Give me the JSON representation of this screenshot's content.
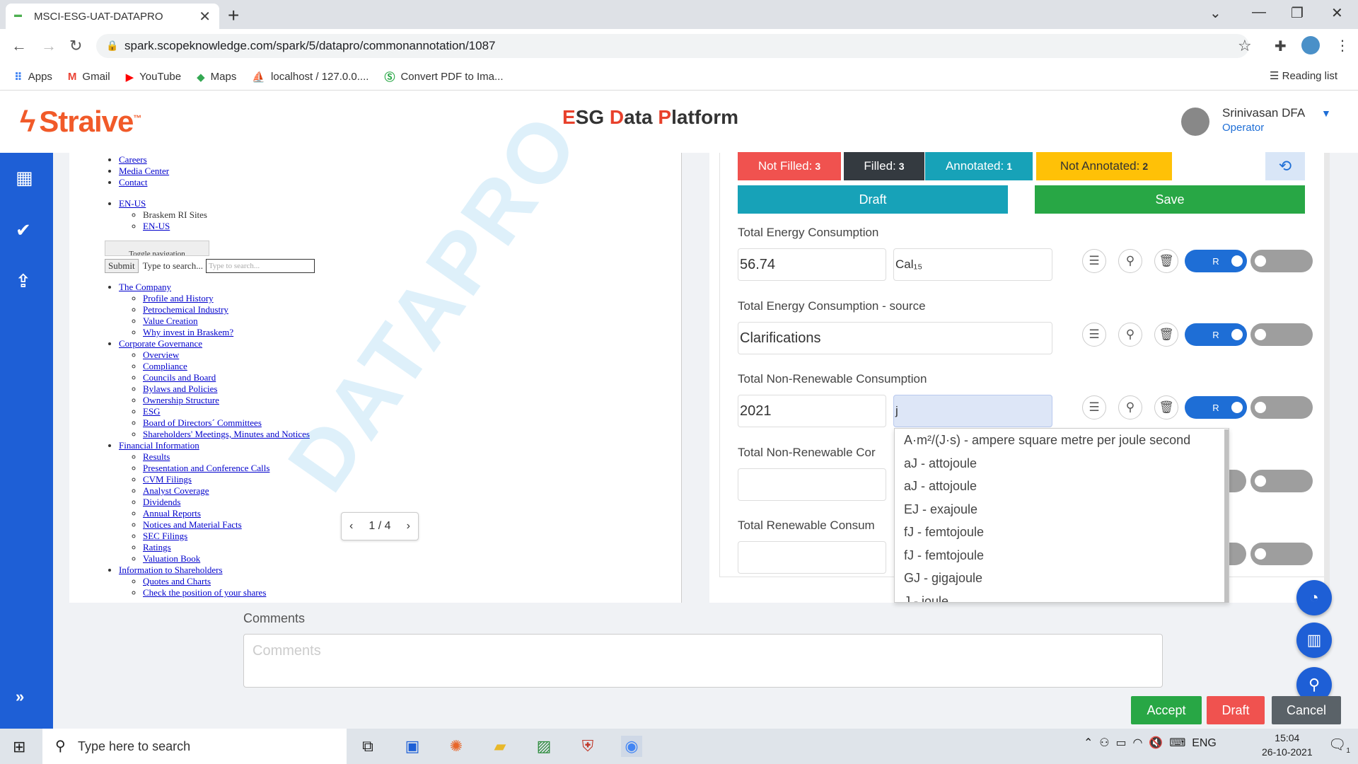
{
  "browser": {
    "tab_title": "MSCI-ESG-UAT-DATAPRO",
    "url": "spark.scopeknowledge.com/spark/5/datapro/commonannotation/1087",
    "bookmarks": [
      {
        "label": "Apps",
        "icon": "apps-grid-icon"
      },
      {
        "label": "Gmail",
        "icon": "gmail-icon"
      },
      {
        "label": "YouTube",
        "icon": "youtube-icon"
      },
      {
        "label": "Maps",
        "icon": "maps-icon"
      },
      {
        "label": "localhost / 127.0.0....",
        "icon": "phpmyadmin-icon"
      },
      {
        "label": "Convert PDF to Ima...",
        "icon": "convert-icon"
      }
    ],
    "reading_list": "Reading list"
  },
  "header": {
    "logo": "Straive",
    "logo_tm": "™",
    "platform_e": "E",
    "platform_sg": "SG ",
    "platform_d": "D",
    "platform_ata": "ata ",
    "platform_p": "P",
    "platform_latform": "latform",
    "user_name": "Srinivasan DFA",
    "user_role": "Operator"
  },
  "document": {
    "top_links": [
      "Careers",
      "Media Center",
      "Contact"
    ],
    "lang_link": "EN-US",
    "lang_sub_text": "Braskem RI Sites",
    "lang_sub_link": "EN-US",
    "toggle_nav": "Toggle navigation",
    "submit_label": "Submit",
    "search_label": "Type to search...",
    "search_placeholder": "Type to search...",
    "sections": [
      {
        "title": "The Company",
        "items": [
          "Profile and History",
          "Petrochemical Industry",
          "Value Creation",
          "Why invest in Braskem?"
        ]
      },
      {
        "title": "Corporate Governance",
        "items": [
          "Overview",
          "Compliance",
          "Councils and Board",
          "Bylaws and Policies",
          "Ownership Structure",
          "ESG",
          "Board of Directors´ Committees",
          "Shareholders' Meetings, Minutes and Notices"
        ]
      },
      {
        "title": "Financial Information",
        "items": [
          "Results",
          "Presentation and Conference Calls",
          "CVM Filings",
          "Analyst Coverage",
          "Dividends",
          "Annual Reports",
          "Notices and Material Facts",
          "SEC Filings",
          "Ratings",
          "Valuation Book"
        ]
      },
      {
        "title": "Information to Shareholders",
        "items": [
          "Quotes and Charts",
          "Check the position of your shares"
        ]
      }
    ],
    "watermark": "DATAPRO",
    "pager": "1 / 4"
  },
  "status": {
    "not_filled_label": "Not Filled:",
    "not_filled_count": "3",
    "filled_label": "Filled:",
    "filled_count": "3",
    "annotated_label": "Annotated:",
    "annotated_count": "1",
    "not_annotated_label": "Not Annotated:",
    "not_annotated_count": "2"
  },
  "actions": {
    "draft": "Draft",
    "save": "Save"
  },
  "fields": [
    {
      "label": "Total Energy Consumption",
      "value": "56.74",
      "unit": "Cal₁₅",
      "toggle": "R"
    },
    {
      "label": "Total Energy Consumption - source",
      "value": "Clarifications",
      "toggle": "R"
    },
    {
      "label": "Total Non-Renewable Consumption",
      "value": "2021",
      "unit": "j",
      "toggle": "R"
    },
    {
      "label": "Total Non-Renewable Cor",
      "value": ""
    },
    {
      "label": "Total Renewable Consum",
      "value": ""
    }
  ],
  "unit_options": [
    "A·m²/(J·s) - ampere square metre per joule second",
    "aJ - attojoule",
    "aJ - attojoule",
    "EJ - exajoule",
    "fJ - femtojoule",
    "fJ - femtojoule",
    "GJ - gigajoule",
    "J - joule"
  ],
  "comments": {
    "label": "Comments",
    "placeholder": "Comments"
  },
  "footer_buttons": {
    "accept": "Accept",
    "draft": "Draft",
    "cancel": "Cancel"
  },
  "taskbar": {
    "search_placeholder": "Type here to search",
    "lang": "ENG",
    "time": "15:04",
    "date": "26-10-2021",
    "notif_count": "1"
  },
  "colors": {
    "not_filled": "#f0524f",
    "filled": "#343a40",
    "annotated": "#17a2b8",
    "not_annotated": "#ffc107",
    "draft": "#17a2b8",
    "save": "#28a745",
    "brand": "#f15a29",
    "sidebar": "#1e5fd6"
  }
}
